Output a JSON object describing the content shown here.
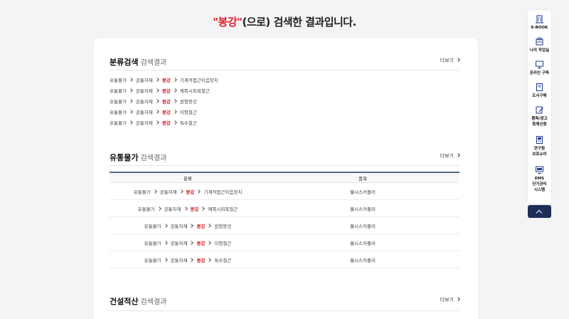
{
  "heading": {
    "quote_open": "\"",
    "keyword": "봉강",
    "quote_close": "\"",
    "rest": "(으로) 검색한 결과입니다."
  },
  "sections": {
    "category": {
      "title": "분류검색",
      "subtitle": "검색결과",
      "more": "더보기"
    },
    "distribution": {
      "title": "유통물가",
      "subtitle": "검색결과",
      "more": "더보기"
    },
    "construction": {
      "title": "건설적산",
      "subtitle": "검색결과",
      "more": "더보기"
    }
  },
  "category_results": [
    [
      "유통물가",
      "공통자재",
      "봉강",
      "기계적접근이음장치"
    ],
    [
      "유통물가",
      "공통자재",
      "봉강",
      "에폭시피복철근"
    ],
    [
      "유통물가",
      "공통자재",
      "봉강",
      "원형봉강"
    ],
    [
      "유통물가",
      "공통자재",
      "봉강",
      "이형철근"
    ],
    [
      "유통물가",
      "공통자재",
      "봉강",
      "특수철근"
    ]
  ],
  "table": {
    "headers": [
      "분류",
      "품목"
    ],
    "rows": [
      {
        "path": [
          "유통물가",
          "공통자재",
          "봉강",
          "기계적접근이음장치"
        ],
        "item": "웰시스커플러"
      },
      {
        "path": [
          "유통물가",
          "공통자재",
          "봉강",
          "에폭시피복철근"
        ],
        "item": "웰시스커플러"
      },
      {
        "path": [
          "유통물가",
          "공통자재",
          "봉강",
          "원형봉강"
        ],
        "item": "웰시스커플러"
      },
      {
        "path": [
          "유통물가",
          "공통자재",
          "봉강",
          "이형철근"
        ],
        "item": "웰시스커플러"
      },
      {
        "path": [
          "유통물가",
          "공통자재",
          "봉강",
          "특수철근"
        ],
        "item": "웰시스커플러"
      }
    ]
  },
  "sidebar": {
    "items": [
      {
        "label": "E-BOOK",
        "icon": "building-icon"
      },
      {
        "label": "나의 작업실",
        "icon": "workroom-icon"
      },
      {
        "label": "온라인 구독",
        "icon": "monitor-icon"
      },
      {
        "label": "도서구매",
        "icon": "book-icon"
      },
      {
        "label": "품목/광고 등재신청",
        "icon": "pencil-icon"
      },
      {
        "label": "연구원 브로슈어",
        "icon": "brochure-icon"
      },
      {
        "label": "EMS 단가관리 시스템",
        "icon": "ems-icon"
      }
    ]
  },
  "colors": {
    "accent": "#d91f28",
    "navy": "#1e2f56",
    "background": "#f4f4f6"
  }
}
